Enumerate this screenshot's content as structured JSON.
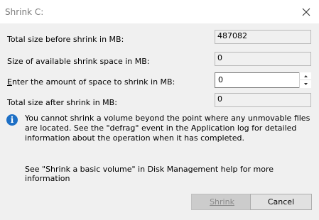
{
  "window": {
    "title": "Shrink C:"
  },
  "fields": [
    {
      "label": "Total size before shrink in MB:",
      "value": "487082"
    },
    {
      "label": "Size of available shrink space in MB:",
      "value": "0"
    },
    {
      "label": "Enter the amount of space to shrink in MB:",
      "value": "0",
      "mnemonic": "E"
    },
    {
      "label": "Total size after shrink in MB:",
      "value": "0"
    }
  ],
  "info": {
    "icon": "info-icon",
    "message": "You cannot shrink a volume beyond the point where any unmovable files are located. See the \"defrag\" event in the Application log for detailed information about the operation when it has completed.",
    "help": "See \"Shrink a basic volume\" in Disk Management help for more information"
  },
  "buttons": {
    "shrink": "Shrink",
    "cancel": "Cancel"
  },
  "colors": {
    "info_icon": "#1d6fc5",
    "title_text": "#7a7a7a"
  }
}
